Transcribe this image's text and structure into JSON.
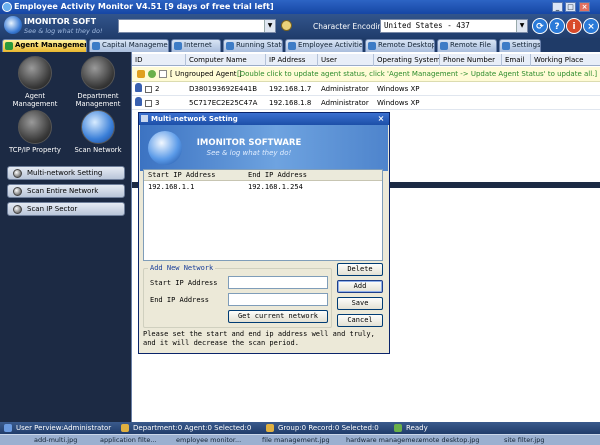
{
  "window": {
    "title": "Employee Activity Monitor V4.51    [9 days of free trial left]"
  },
  "brand": {
    "name": "IMONITOR SOFT",
    "slogan": "See & log what they do!"
  },
  "toolbar": {
    "encoding_label": "Character Encoding",
    "encoding_value": "United States - 437",
    "refresh": "⟳",
    "help": "?",
    "info": "i",
    "close": "×"
  },
  "tabs": [
    {
      "label": "Agent Management"
    },
    {
      "label": "Capital Management"
    },
    {
      "label": "Internet"
    },
    {
      "label": "Running Status"
    },
    {
      "label": "Employee Activities"
    },
    {
      "label": "Remote Desktop"
    },
    {
      "label": "Remote File"
    },
    {
      "label": "Settings"
    }
  ],
  "sidebar": {
    "icons": [
      {
        "label": "Agent Management"
      },
      {
        "label": "Department Management"
      },
      {
        "label": "TCP/IP Property"
      },
      {
        "label": "Scan Network"
      }
    ],
    "buttons": [
      {
        "label": "Multi-network Setting"
      },
      {
        "label": "Scan Entire Network"
      },
      {
        "label": "Scan IP Sector"
      }
    ]
  },
  "table": {
    "columns": [
      "ID",
      "Computer Name",
      "IP Address",
      "User",
      "Operating System",
      "Phone Number",
      "Email",
      "Working Place"
    ],
    "group_row": {
      "text": "[ Ungrouped Agent ]",
      "hint": "[Double click to update agent status, click 'Agent Management -> Update Agent Status' to update all.]"
    },
    "rows": [
      {
        "id": "2",
        "computer": "D380193692E441B",
        "ip": "192.168.1.7",
        "user": "Administrator",
        "os": "Windows XP"
      },
      {
        "id": "3",
        "computer": "5C717EC2E25C47A",
        "ip": "192.168.1.8",
        "user": "Administrator",
        "os": "Windows XP"
      }
    ]
  },
  "dialog": {
    "title": "Multi-network Setting",
    "banner_title": "IMONITOR SOFTWARE",
    "banner_sub": "See & log what they do!",
    "list_columns": [
      "Start IP Address",
      "End IP Address"
    ],
    "list_rows": [
      {
        "start": "192.168.1.1",
        "end": "192.168.1.254"
      }
    ],
    "group_label": "Add New Network",
    "start_label": "Start IP Address",
    "end_label": "End IP Address",
    "start_value": "",
    "end_value": "",
    "get_current": "Get current network",
    "delete": "Delete",
    "add": "Add",
    "save": "Save",
    "cancel": "Cancel",
    "note": "Please set the start and end ip address well and truly, and it will decrease the scan period."
  },
  "status": {
    "user": "User Perview:Administrator",
    "dept": "Department:0  Agent:0  Selected:0",
    "group": "Group:0  Record:0  Selected:0",
    "ready": "Ready"
  },
  "taskbar": [
    "add-multi.jpg",
    "application filte...",
    "employee monitor...",
    "file management.jpg",
    "hardware manageme...",
    "remote desktop.jpg",
    "site filter.jpg"
  ],
  "colors": {
    "accent": "#1646a4",
    "active_tab": "#e9b830",
    "hint_text": "#2a8a2a"
  }
}
